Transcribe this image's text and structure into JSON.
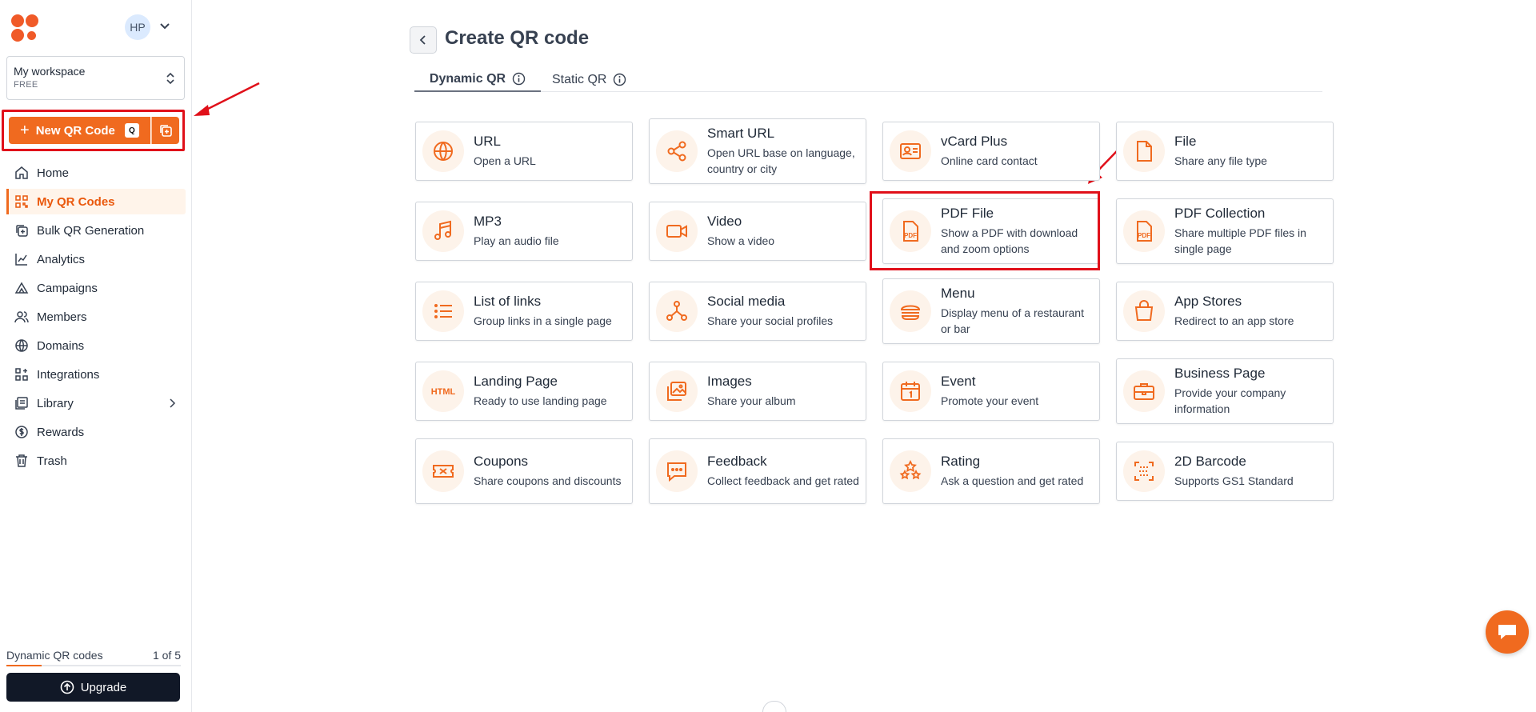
{
  "sidebar": {
    "avatar": "HP",
    "workspace": {
      "name": "My workspace",
      "plan": "FREE"
    },
    "new_qr": {
      "label": "New QR Code",
      "shortcut": "Q"
    },
    "items": [
      {
        "label": "Home",
        "icon": "home-icon"
      },
      {
        "label": "My QR Codes",
        "icon": "grid-icon",
        "active": true
      },
      {
        "label": "Bulk QR Generation",
        "icon": "bulk-icon"
      },
      {
        "label": "Analytics",
        "icon": "analytics-icon"
      },
      {
        "label": "Campaigns",
        "icon": "campaign-icon"
      },
      {
        "label": "Members",
        "icon": "members-icon"
      },
      {
        "label": "Domains",
        "icon": "globe-icon"
      },
      {
        "label": "Integrations",
        "icon": "integrations-icon"
      },
      {
        "label": "Library",
        "icon": "library-icon"
      },
      {
        "label": "Rewards",
        "icon": "rewards-icon"
      },
      {
        "label": "Trash",
        "icon": "trash-icon"
      }
    ],
    "quota": {
      "label": "Dynamic QR codes",
      "value": "1 of 5",
      "fraction": 0.2
    },
    "upgrade_label": "Upgrade"
  },
  "main": {
    "title": "Create QR code",
    "tabs": [
      {
        "label": "Dynamic QR"
      },
      {
        "label": "Static QR"
      }
    ],
    "cards": [
      {
        "title": "URL",
        "desc": "Open a URL",
        "icon": "globe-icon"
      },
      {
        "title": "Smart URL",
        "desc": "Open URL base on language, country or city",
        "icon": "share-icon"
      },
      {
        "title": "vCard Plus",
        "desc": "Online card contact",
        "icon": "contact-card-icon"
      },
      {
        "title": "File",
        "desc": "Share any file type",
        "icon": "file-icon"
      },
      {
        "title": "MP3",
        "desc": "Play an audio file",
        "icon": "music-icon"
      },
      {
        "title": "Video",
        "desc": "Show a video",
        "icon": "video-icon"
      },
      {
        "title": "PDF File",
        "desc": "Show a PDF with download and zoom options",
        "icon": "pdf-icon"
      },
      {
        "title": "PDF Collection",
        "desc": "Share multiple PDF files in single page",
        "icon": "pdf-icon"
      },
      {
        "title": "List of links",
        "desc": "Group links in a single page",
        "icon": "list-icon"
      },
      {
        "title": "Social media",
        "desc": "Share your social profiles",
        "icon": "social-icon"
      },
      {
        "title": "Menu",
        "desc": "Display menu of a restaurant or bar",
        "icon": "burger-icon"
      },
      {
        "title": "App Stores",
        "desc": "Redirect to an app store",
        "icon": "shopping-bag-icon"
      },
      {
        "title": "Landing Page",
        "desc": "Ready to use landing page",
        "icon": "html-icon"
      },
      {
        "title": "Images",
        "desc": "Share your album",
        "icon": "images-icon"
      },
      {
        "title": "Event",
        "desc": "Promote your event",
        "icon": "calendar-icon"
      },
      {
        "title": "Business Page",
        "desc": "Provide your company information",
        "icon": "briefcase-icon"
      },
      {
        "title": "Coupons",
        "desc": "Share coupons and discounts",
        "icon": "ticket-icon"
      },
      {
        "title": "Feedback",
        "desc": "Collect feedback and get rated",
        "icon": "chat-icon"
      },
      {
        "title": "Rating",
        "desc": "Ask a question and get rated",
        "icon": "stars-icon"
      },
      {
        "title": "2D Barcode",
        "desc": "Supports GS1 Standard",
        "icon": "barcode-icon"
      }
    ],
    "html_icon_text": "HTML",
    "pdf_icon_text": "PDF"
  },
  "colors": {
    "accent": "#f06a1f",
    "annotation": "#e0101a",
    "dark": "#111827"
  }
}
